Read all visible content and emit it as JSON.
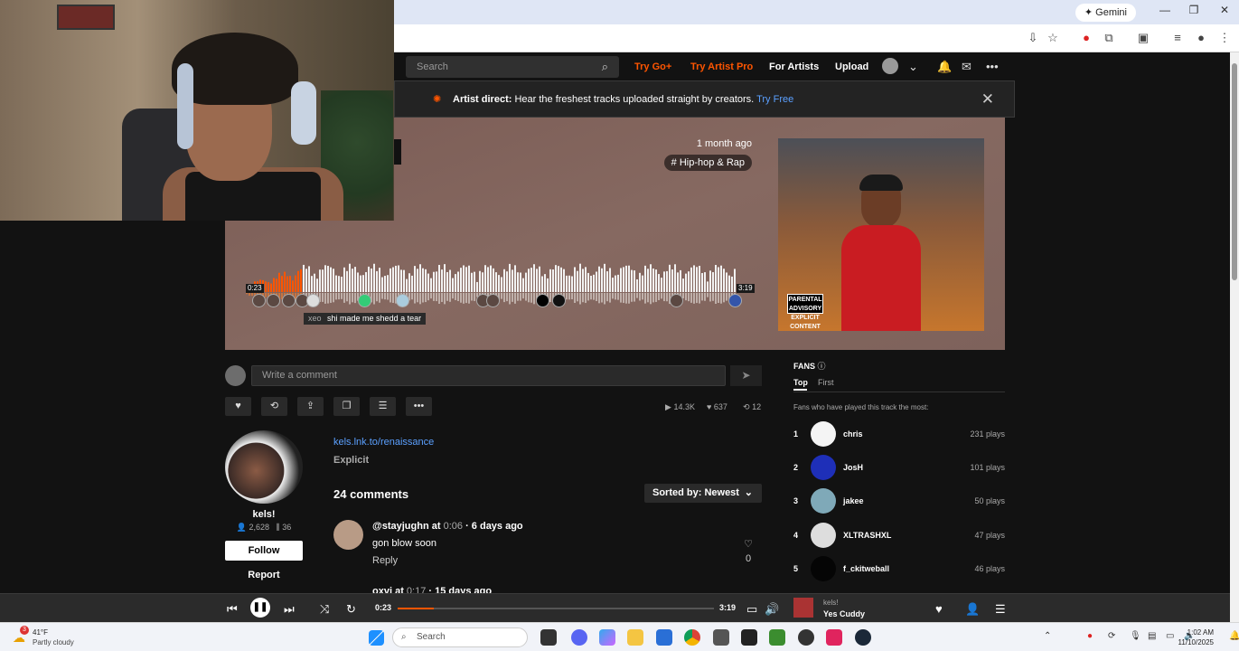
{
  "browser": {
    "gemini_label": "Gemini",
    "gemini_icon": "sparkle-icon",
    "window_controls": [
      "—",
      "❐",
      "✕"
    ]
  },
  "header": {
    "search_placeholder": "Search",
    "try_go": "Try Go+",
    "try_artist_pro": "Try Artist Pro",
    "for_artists": "For Artists",
    "upload": "Upload"
  },
  "banner": {
    "bold": "Artist direct:",
    "text": "Hear the freshest tracks uploaded straight by creators.",
    "cta": "Try Free",
    "close": "✕"
  },
  "hero": {
    "posted_ago": "1 month ago",
    "genre_tag": "# Hip-hop & Rap",
    "current_time": "0:23",
    "duration": "3:19",
    "played_fraction": 0.115,
    "comment_tip_user": "xeo",
    "comment_tip_text": "shi made me shedd a tear",
    "cover_label": "PARENTAL ADVISORY EXPLICIT CONTENT"
  },
  "comment_box": {
    "placeholder": "Write a comment"
  },
  "stats": {
    "plays": "14.3K",
    "likes": "637",
    "reposts": "12"
  },
  "artist": {
    "name": "kels!",
    "followers": "2,628",
    "tracks": "36",
    "follow_label": "Follow",
    "report_label": "Report"
  },
  "description": {
    "link": "kels.lnk.to/renaissance",
    "explicit": "Explicit"
  },
  "comments": {
    "count_label": "24 comments",
    "sort_label": "Sorted by: Newest",
    "items": [
      {
        "user": "@stayjughn",
        "at": "at",
        "time": "0:06",
        "ago": "· 6 days ago",
        "text": "gon blow soon",
        "reply": "Reply",
        "likes": "0"
      },
      {
        "user": "oxvi",
        "at": "at",
        "time": "0:17",
        "ago": "· 15 days ago"
      }
    ]
  },
  "fans": {
    "title": "FANS",
    "tab_top": "Top",
    "tab_first": "First",
    "subtitle": "Fans who have played this track the most:",
    "list": [
      {
        "rank": "1",
        "name": "chris",
        "plays": "231 plays",
        "color": "#f4f4f4"
      },
      {
        "rank": "2",
        "name": "JosH",
        "plays": "101 plays",
        "color": "#1e2fb8"
      },
      {
        "rank": "3",
        "name": "jakee",
        "plays": "50 plays",
        "color": "#7fa9b8"
      },
      {
        "rank": "4",
        "name": "XLTRASHXL",
        "plays": "47 plays",
        "color": "#ddd"
      },
      {
        "rank": "5",
        "name": "f_ckitweball",
        "plays": "46 plays",
        "color": "#050505"
      }
    ]
  },
  "player": {
    "current": "0:23",
    "duration": "3:19",
    "progress": 0.115,
    "artist": "kels!",
    "title": "Yes Cuddy"
  },
  "taskbar": {
    "temperature": "41°F",
    "condition": "Partly cloudy",
    "weather_badge": "3",
    "search_placeholder": "Search",
    "time": "1:02 AM",
    "date": "11/10/2025"
  },
  "colors": {
    "accent": "#ff5500",
    "link": "#5ba0ff"
  }
}
